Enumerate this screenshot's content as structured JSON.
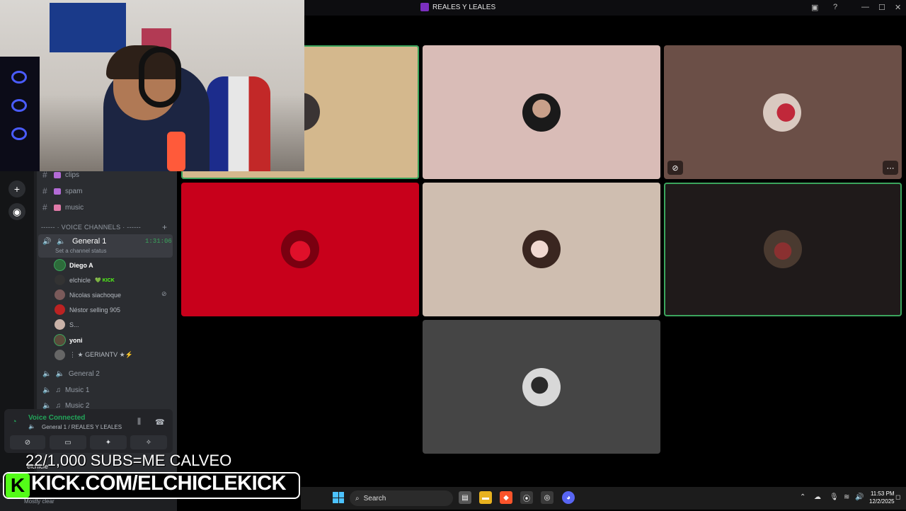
{
  "window": {
    "title": "REALES Y LEALES"
  },
  "channels": {
    "text": [
      {
        "label": "clips"
      },
      {
        "label": "spam"
      },
      {
        "label": "music"
      }
    ],
    "voice_section": "------ · VOICE CHANNELS · ------",
    "active_voice": {
      "name": "General 1",
      "time": "1:31:06",
      "status": "Set a channel status"
    },
    "members": [
      {
        "name": "Diego A",
        "bold": true
      },
      {
        "name": "elchicle",
        "badge": "KICK"
      },
      {
        "name": "Nicolas siachoque",
        "muted": true
      },
      {
        "name": "Néstor selling 905"
      },
      {
        "name": "S..."
      },
      {
        "name": "yoni",
        "bold": true
      },
      {
        "name": "⋮ ★ GERIANTV ★⚡"
      }
    ],
    "other_voice": [
      {
        "name": "General 2"
      },
      {
        "name": "Music 1"
      },
      {
        "name": "Music 2"
      }
    ]
  },
  "voice_panel": {
    "title": "Voice Connected",
    "subtitle": "General 1 / REALES Y LEALES"
  },
  "user": {
    "name": "elchicle",
    "status": "Mostly clear"
  },
  "stream_overlay": {
    "subs_text": "22/1,000 SUBS=ME CALVEO",
    "kick_url": "KICK.COM/ELCHICLEKICK"
  },
  "taskbar": {
    "search_label": "Search",
    "time": "11:53 PM",
    "date": "12/2/2025"
  },
  "colors": {
    "speaking_border": "#3ba55d",
    "kick_green": "#53fc18",
    "tile_1": "#d4b88d",
    "tile_2": "#d9bcb7",
    "tile_3": "#6b4f47",
    "tile_4": "#c8001b",
    "tile_5": "#cfbeb0",
    "tile_6": "#1f1a1a",
    "tile_7": "#454545"
  }
}
